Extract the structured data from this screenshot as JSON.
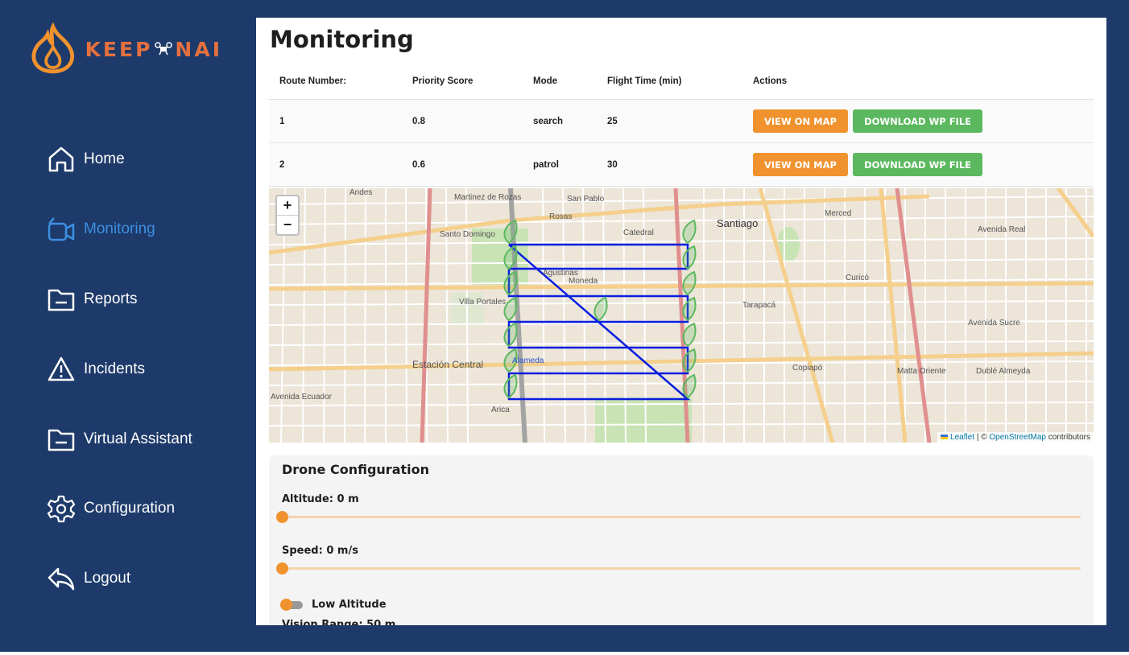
{
  "app": {
    "logo_left": "KEEP",
    "logo_right": "NAI",
    "colors": {
      "sidebar_bg": "#1d3a6a",
      "accent_orange": "#f0922e",
      "accent_green": "#5bb85e",
      "active_blue": "#3d8fe0"
    }
  },
  "sidebar": {
    "items": [
      {
        "label": "Home",
        "icon": "home-icon"
      },
      {
        "label": "Monitoring",
        "icon": "video-camera-icon",
        "active": true
      },
      {
        "label": "Reports",
        "icon": "folder-icon"
      },
      {
        "label": "Incidents",
        "icon": "warning-icon"
      },
      {
        "label": "Virtual Assistant",
        "icon": "folder-icon"
      },
      {
        "label": "Configuration",
        "icon": "gear-icon"
      },
      {
        "label": "Logout",
        "icon": "logout-icon"
      }
    ]
  },
  "page": {
    "title": "Monitoring"
  },
  "routes_table": {
    "headers": [
      "Route Number:",
      "Priority Score",
      "Mode",
      "Flight Time (min)",
      "Actions"
    ],
    "rows": [
      {
        "route": "1",
        "priority": "0.8",
        "mode": "search",
        "flight_time": "25"
      },
      {
        "route": "2",
        "priority": "0.6",
        "mode": "patrol",
        "flight_time": "30"
      }
    ],
    "view_label": "VIEW ON MAP",
    "download_label": "DOWNLOAD WP FILE"
  },
  "map": {
    "zoom_in": "+",
    "zoom_out": "−",
    "attribution_leaflet": "Leaflet",
    "attribution_sep": " | © ",
    "attribution_osm": "OpenStreetMap",
    "attribution_tail": " contributors",
    "labels": [
      "Santiago",
      "Estación Central",
      "Alameda",
      "Andes",
      "Martinez de Rozas",
      "San Pablo",
      "Rosas",
      "Catedral",
      "Moneda",
      "Santo Domingo",
      "Villa Portales",
      "Merced",
      "Tarapacá",
      "Avenida Ecuador",
      "Arica",
      "Curicó",
      "Avenida Sucre",
      "Matta Oriente",
      "Dublé Almeyda",
      "Avenida Real",
      "Agustinas",
      "Copiapó"
    ]
  },
  "drone_config": {
    "title": "Drone Configuration",
    "altitude_label": "Altitude: 0 m",
    "altitude_value": 0,
    "speed_label": "Speed: 0 m/s",
    "speed_value": 0,
    "low_altitude_label": "Low Altitude",
    "vision_range_label": "Vision Range: 50 m"
  }
}
